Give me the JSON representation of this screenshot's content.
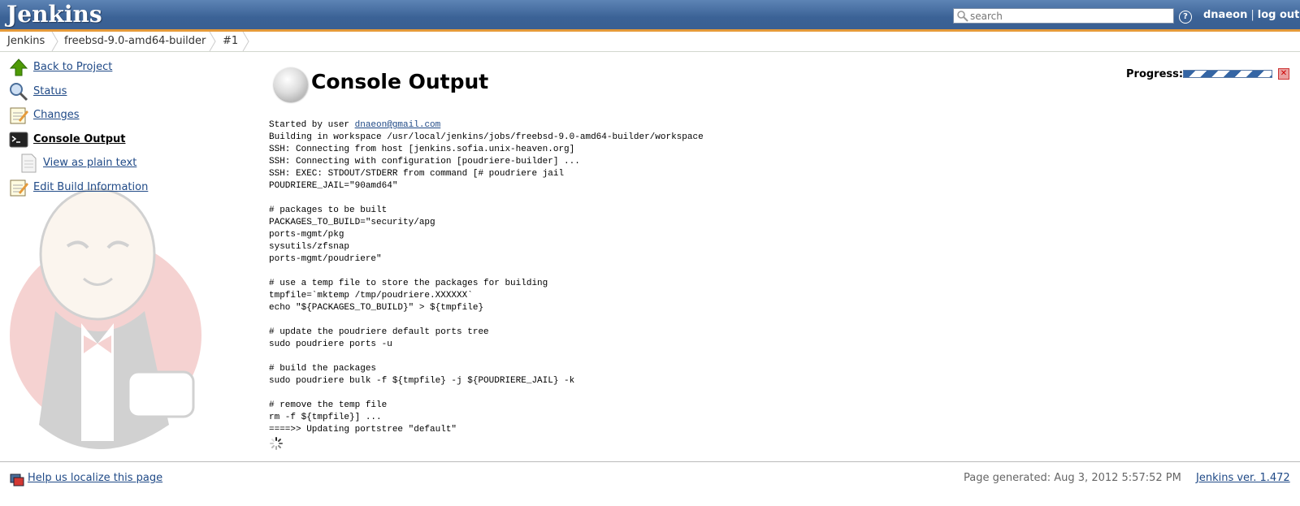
{
  "header": {
    "logo": "Jenkins",
    "search_placeholder": "search",
    "help": "?",
    "user": "dnaeon",
    "separator": "|",
    "logout": "log out"
  },
  "breadcrumb": [
    "Jenkins",
    "freebsd-9.0-amd64-builder",
    "#1"
  ],
  "sidebar": {
    "items": [
      {
        "label": "Back to Project",
        "icon": "up-arrow-icon"
      },
      {
        "label": "Status",
        "icon": "magnifier-icon"
      },
      {
        "label": "Changes",
        "icon": "notepad-icon"
      },
      {
        "label": "Console Output",
        "icon": "terminal-icon"
      },
      {
        "label": "View as plain text",
        "icon": "document-icon"
      },
      {
        "label": "Edit Build Information",
        "icon": "notepad-icon"
      }
    ]
  },
  "main": {
    "title": "Console Output",
    "progress_label": "Progress:",
    "console_first_prefix": "Started by user ",
    "console_user_link": "dnaeon@gmail.com",
    "console_rest": "Building in workspace /usr/local/jenkins/jobs/freebsd-9.0-amd64-builder/workspace\nSSH: Connecting from host [jenkins.sofia.unix-heaven.org]\nSSH: Connecting with configuration [poudriere-builder] ...\nSSH: EXEC: STDOUT/STDERR from command [# poudriere jail\nPOUDRIERE_JAIL=\"90amd64\"\n\n# packages to be built\nPACKAGES_TO_BUILD=\"security/apg\nports-mgmt/pkg\nsysutils/zfsnap\nports-mgmt/poudriere\"\n\n# use a temp file to store the packages for building\ntmpfile=`mktemp /tmp/poudriere.XXXXXX`\necho \"${PACKAGES_TO_BUILD}\" > ${tmpfile}\n\n# update the poudriere default ports tree\nsudo poudriere ports -u\n\n# build the packages\nsudo poudriere bulk -f ${tmpfile} -j ${POUDRIERE_JAIL} -k\n\n# remove the temp file\nrm -f ${tmpfile}] ...\n====>> Updating portstree \"default\""
  },
  "footer": {
    "localize": "Help us localize this page",
    "generated": "Page generated: Aug 3, 2012 5:57:52 PM",
    "version": "Jenkins ver. 1.472"
  },
  "colors": {
    "header_blue": "#3b6296",
    "header_accent": "#e59a3a",
    "link": "#204a87"
  }
}
